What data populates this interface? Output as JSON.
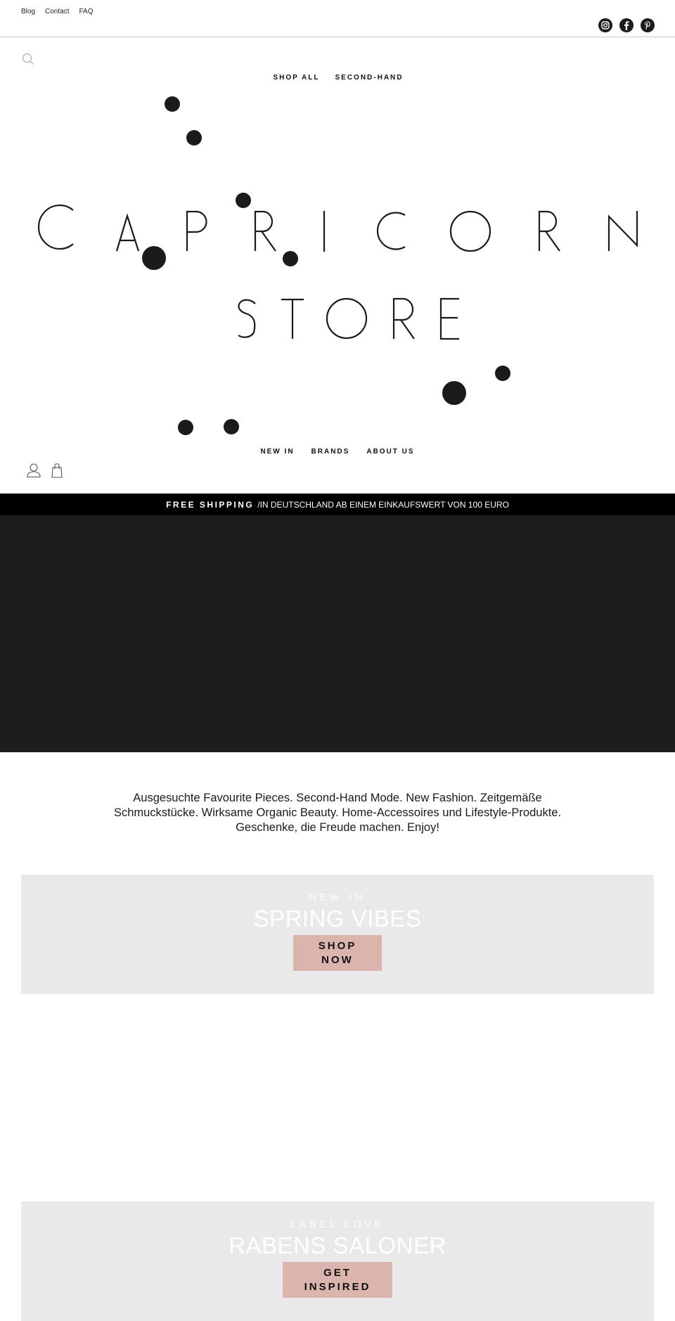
{
  "utility_nav": {
    "links": [
      {
        "label": "Blog"
      },
      {
        "label": "Contact"
      },
      {
        "label": "FAQ"
      }
    ]
  },
  "social": [
    {
      "icon": "instagram-icon",
      "label": "Instagram"
    },
    {
      "icon": "facebook-icon",
      "label": "Facebook"
    },
    {
      "icon": "pinterest-icon",
      "label": "Pinterest"
    }
  ],
  "header": {
    "search_icon": "search-icon",
    "account_icon": "user-icon",
    "cart_icon": "shopping-bag-icon"
  },
  "nav_upper": [
    {
      "label": "SHOP ALL"
    },
    {
      "label": "SECOND-HAND"
    }
  ],
  "logo": {
    "line1": [
      "C",
      "A",
      "P",
      "R",
      "I",
      "C",
      "O",
      "R",
      "N"
    ],
    "line2": [
      "S",
      "T",
      "O",
      "R",
      "E"
    ],
    "alt": "CAPRICORN STORE"
  },
  "nav_lower": [
    {
      "label": "NEW IN"
    },
    {
      "label": "BRANDS"
    },
    {
      "label": "ABOUT US"
    }
  ],
  "announcement": {
    "strong": "FREE SHIPPING",
    "rest": "/IN DEUTSCHLAND AB EINEM EINKAUFSWERT VON 100 EURO"
  },
  "intro": {
    "text": "Ausgesuchte Favourite Pieces. Second-Hand Mode. New Fashion. Zeitgemäße Schmuckstücke. Wirksame Organic Beauty. Home-Accessoires und Lifestyle-Produkte. Geschenke, die Freude machen. Enjoy!"
  },
  "promos": [
    {
      "eyebrow": "NEW IN",
      "title": "SPRING VIBES",
      "cta_line1": "SHOP",
      "cta_line2": "NOW"
    },
    {
      "eyebrow": "LABEL LOVE",
      "title": "RABENS SALONER",
      "cta_line1": "GET",
      "cta_line2": "INSPIRED"
    }
  ],
  "colors": {
    "accent_button": "#dbb5ad",
    "announcement_bg": "#000000",
    "hero_bg": "#1c1d1f",
    "promo_bg": "#e9e9e9"
  }
}
